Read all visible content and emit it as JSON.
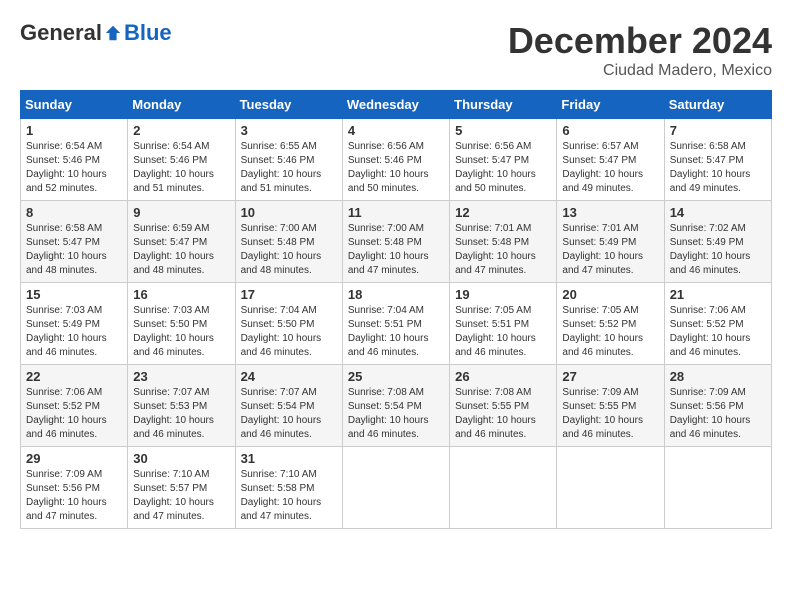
{
  "logo": {
    "general": "General",
    "blue": "Blue"
  },
  "title": "December 2024",
  "subtitle": "Ciudad Madero, Mexico",
  "weekdays": [
    "Sunday",
    "Monday",
    "Tuesday",
    "Wednesday",
    "Thursday",
    "Friday",
    "Saturday"
  ],
  "weeks": [
    [
      {
        "day": "1",
        "sunrise": "6:54 AM",
        "sunset": "5:46 PM",
        "daylight": "10 hours and 52 minutes."
      },
      {
        "day": "2",
        "sunrise": "6:54 AM",
        "sunset": "5:46 PM",
        "daylight": "10 hours and 51 minutes."
      },
      {
        "day": "3",
        "sunrise": "6:55 AM",
        "sunset": "5:46 PM",
        "daylight": "10 hours and 51 minutes."
      },
      {
        "day": "4",
        "sunrise": "6:56 AM",
        "sunset": "5:46 PM",
        "daylight": "10 hours and 50 minutes."
      },
      {
        "day": "5",
        "sunrise": "6:56 AM",
        "sunset": "5:47 PM",
        "daylight": "10 hours and 50 minutes."
      },
      {
        "day": "6",
        "sunrise": "6:57 AM",
        "sunset": "5:47 PM",
        "daylight": "10 hours and 49 minutes."
      },
      {
        "day": "7",
        "sunrise": "6:58 AM",
        "sunset": "5:47 PM",
        "daylight": "10 hours and 49 minutes."
      }
    ],
    [
      {
        "day": "8",
        "sunrise": "6:58 AM",
        "sunset": "5:47 PM",
        "daylight": "10 hours and 48 minutes."
      },
      {
        "day": "9",
        "sunrise": "6:59 AM",
        "sunset": "5:47 PM",
        "daylight": "10 hours and 48 minutes."
      },
      {
        "day": "10",
        "sunrise": "7:00 AM",
        "sunset": "5:48 PM",
        "daylight": "10 hours and 48 minutes."
      },
      {
        "day": "11",
        "sunrise": "7:00 AM",
        "sunset": "5:48 PM",
        "daylight": "10 hours and 47 minutes."
      },
      {
        "day": "12",
        "sunrise": "7:01 AM",
        "sunset": "5:48 PM",
        "daylight": "10 hours and 47 minutes."
      },
      {
        "day": "13",
        "sunrise": "7:01 AM",
        "sunset": "5:49 PM",
        "daylight": "10 hours and 47 minutes."
      },
      {
        "day": "14",
        "sunrise": "7:02 AM",
        "sunset": "5:49 PM",
        "daylight": "10 hours and 46 minutes."
      }
    ],
    [
      {
        "day": "15",
        "sunrise": "7:03 AM",
        "sunset": "5:49 PM",
        "daylight": "10 hours and 46 minutes."
      },
      {
        "day": "16",
        "sunrise": "7:03 AM",
        "sunset": "5:50 PM",
        "daylight": "10 hours and 46 minutes."
      },
      {
        "day": "17",
        "sunrise": "7:04 AM",
        "sunset": "5:50 PM",
        "daylight": "10 hours and 46 minutes."
      },
      {
        "day": "18",
        "sunrise": "7:04 AM",
        "sunset": "5:51 PM",
        "daylight": "10 hours and 46 minutes."
      },
      {
        "day": "19",
        "sunrise": "7:05 AM",
        "sunset": "5:51 PM",
        "daylight": "10 hours and 46 minutes."
      },
      {
        "day": "20",
        "sunrise": "7:05 AM",
        "sunset": "5:52 PM",
        "daylight": "10 hours and 46 minutes."
      },
      {
        "day": "21",
        "sunrise": "7:06 AM",
        "sunset": "5:52 PM",
        "daylight": "10 hours and 46 minutes."
      }
    ],
    [
      {
        "day": "22",
        "sunrise": "7:06 AM",
        "sunset": "5:52 PM",
        "daylight": "10 hours and 46 minutes."
      },
      {
        "day": "23",
        "sunrise": "7:07 AM",
        "sunset": "5:53 PM",
        "daylight": "10 hours and 46 minutes."
      },
      {
        "day": "24",
        "sunrise": "7:07 AM",
        "sunset": "5:54 PM",
        "daylight": "10 hours and 46 minutes."
      },
      {
        "day": "25",
        "sunrise": "7:08 AM",
        "sunset": "5:54 PM",
        "daylight": "10 hours and 46 minutes."
      },
      {
        "day": "26",
        "sunrise": "7:08 AM",
        "sunset": "5:55 PM",
        "daylight": "10 hours and 46 minutes."
      },
      {
        "day": "27",
        "sunrise": "7:09 AM",
        "sunset": "5:55 PM",
        "daylight": "10 hours and 46 minutes."
      },
      {
        "day": "28",
        "sunrise": "7:09 AM",
        "sunset": "5:56 PM",
        "daylight": "10 hours and 46 minutes."
      }
    ],
    [
      {
        "day": "29",
        "sunrise": "7:09 AM",
        "sunset": "5:56 PM",
        "daylight": "10 hours and 47 minutes."
      },
      {
        "day": "30",
        "sunrise": "7:10 AM",
        "sunset": "5:57 PM",
        "daylight": "10 hours and 47 minutes."
      },
      {
        "day": "31",
        "sunrise": "7:10 AM",
        "sunset": "5:58 PM",
        "daylight": "10 hours and 47 minutes."
      },
      null,
      null,
      null,
      null
    ]
  ],
  "labels": {
    "sunrise_prefix": "Sunrise: ",
    "sunset_prefix": "Sunset: ",
    "daylight_prefix": "Daylight: "
  }
}
